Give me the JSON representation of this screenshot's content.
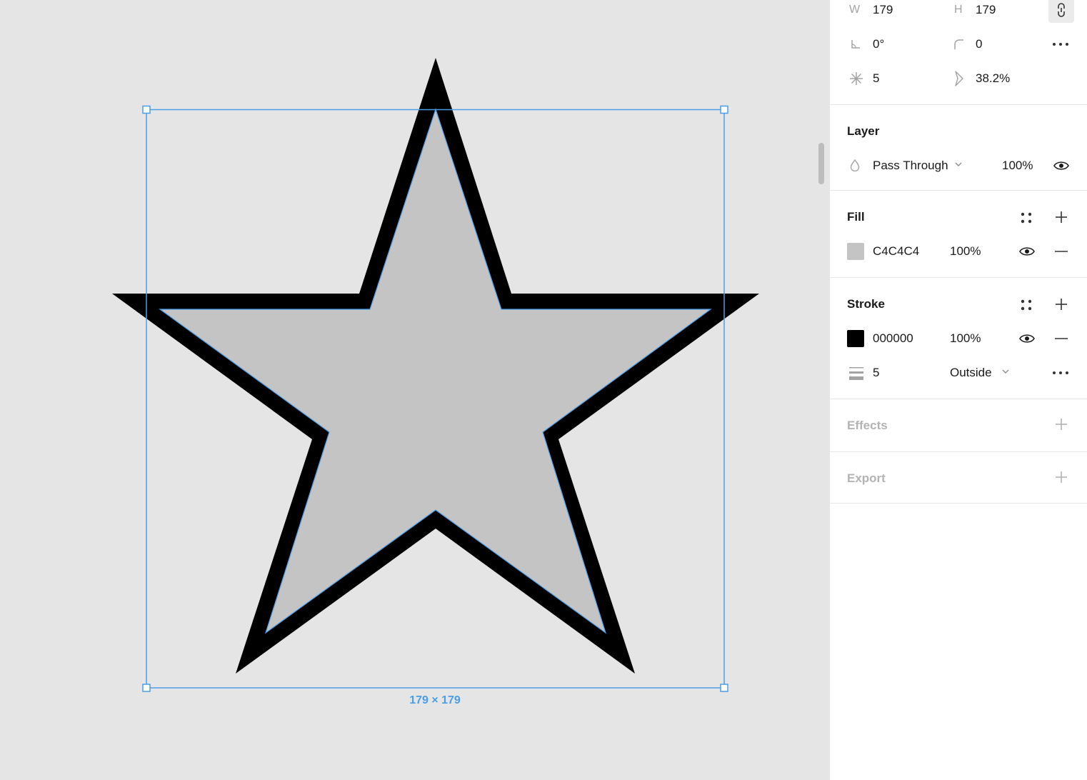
{
  "canvas": {
    "selection_size_label": "179 × 179",
    "shape_fill_color": "#C4C4C4",
    "shape_stroke_color": "#000000",
    "selection_color": "#4a9de8"
  },
  "transform": {
    "width_label": "W",
    "width_value": "179",
    "height_label": "H",
    "height_value": "179",
    "rotation_value": "0°",
    "corner_radius_value": "0",
    "star_points_value": "5",
    "star_ratio_value": "38.2%"
  },
  "layer": {
    "title": "Layer",
    "blend_mode": "Pass Through",
    "opacity": "100%"
  },
  "fill": {
    "title": "Fill",
    "color_hex": "C4C4C4",
    "opacity": "100%",
    "swatch_color": "#C4C4C4"
  },
  "stroke": {
    "title": "Stroke",
    "color_hex": "000000",
    "opacity": "100%",
    "swatch_color": "#000000",
    "weight": "5",
    "position": "Outside"
  },
  "effects": {
    "title": "Effects"
  },
  "export": {
    "title": "Export"
  }
}
